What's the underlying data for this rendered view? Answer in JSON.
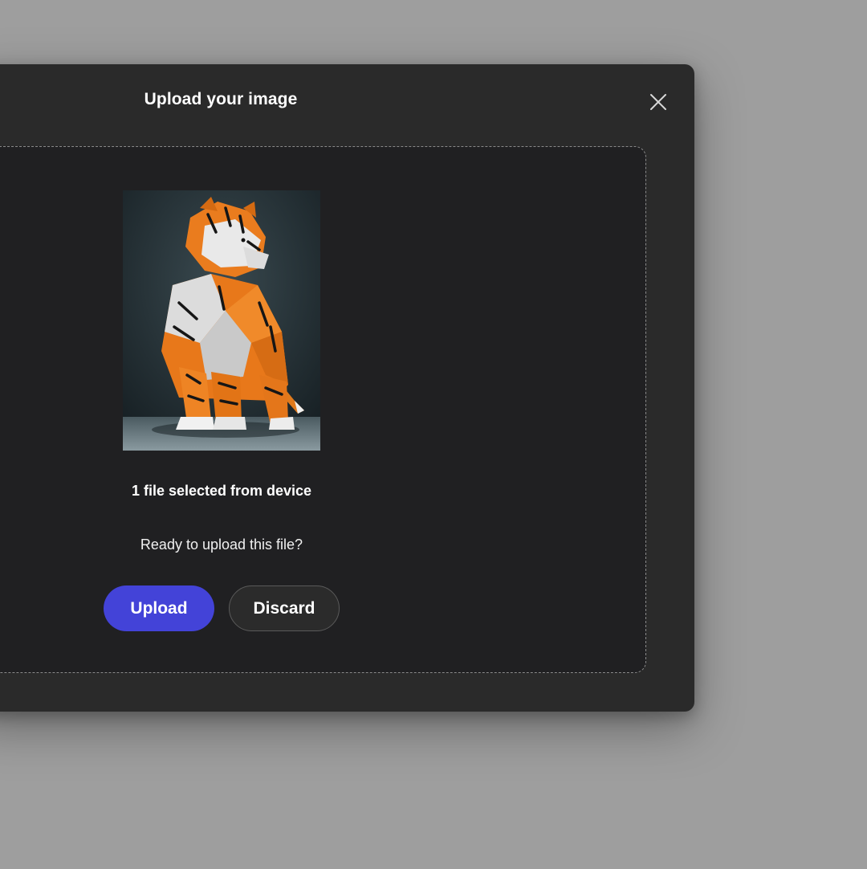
{
  "dialog": {
    "title": "Upload your image",
    "close_icon": "close-icon"
  },
  "dropzone": {
    "preview_icon": "origami-tiger-image",
    "file_count_text": "1 file selected from device",
    "prompt_text": "Ready to upload this file?",
    "upload_label": "Upload",
    "discard_label": "Discard"
  },
  "colors": {
    "accent": "#4343d8",
    "dialog_bg": "#2a2a2a",
    "backdrop": "#9e9e9e"
  }
}
